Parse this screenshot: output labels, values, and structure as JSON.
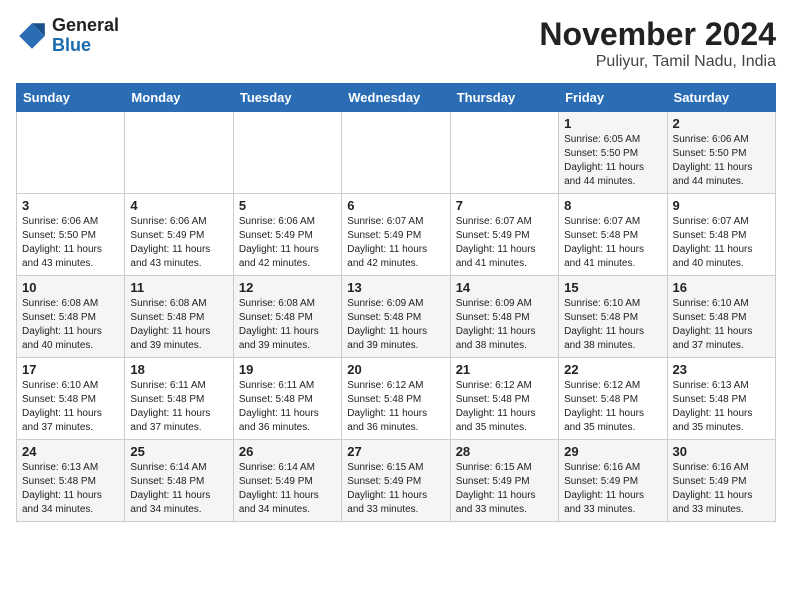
{
  "logo": {
    "general": "General",
    "blue": "Blue"
  },
  "title": "November 2024",
  "subtitle": "Puliyur, Tamil Nadu, India",
  "weekdays": [
    "Sunday",
    "Monday",
    "Tuesday",
    "Wednesday",
    "Thursday",
    "Friday",
    "Saturday"
  ],
  "weeks": [
    [
      {
        "day": "",
        "info": ""
      },
      {
        "day": "",
        "info": ""
      },
      {
        "day": "",
        "info": ""
      },
      {
        "day": "",
        "info": ""
      },
      {
        "day": "",
        "info": ""
      },
      {
        "day": "1",
        "info": "Sunrise: 6:05 AM\nSunset: 5:50 PM\nDaylight: 11 hours\nand 44 minutes."
      },
      {
        "day": "2",
        "info": "Sunrise: 6:06 AM\nSunset: 5:50 PM\nDaylight: 11 hours\nand 44 minutes."
      }
    ],
    [
      {
        "day": "3",
        "info": "Sunrise: 6:06 AM\nSunset: 5:50 PM\nDaylight: 11 hours\nand 43 minutes."
      },
      {
        "day": "4",
        "info": "Sunrise: 6:06 AM\nSunset: 5:49 PM\nDaylight: 11 hours\nand 43 minutes."
      },
      {
        "day": "5",
        "info": "Sunrise: 6:06 AM\nSunset: 5:49 PM\nDaylight: 11 hours\nand 42 minutes."
      },
      {
        "day": "6",
        "info": "Sunrise: 6:07 AM\nSunset: 5:49 PM\nDaylight: 11 hours\nand 42 minutes."
      },
      {
        "day": "7",
        "info": "Sunrise: 6:07 AM\nSunset: 5:49 PM\nDaylight: 11 hours\nand 41 minutes."
      },
      {
        "day": "8",
        "info": "Sunrise: 6:07 AM\nSunset: 5:48 PM\nDaylight: 11 hours\nand 41 minutes."
      },
      {
        "day": "9",
        "info": "Sunrise: 6:07 AM\nSunset: 5:48 PM\nDaylight: 11 hours\nand 40 minutes."
      }
    ],
    [
      {
        "day": "10",
        "info": "Sunrise: 6:08 AM\nSunset: 5:48 PM\nDaylight: 11 hours\nand 40 minutes."
      },
      {
        "day": "11",
        "info": "Sunrise: 6:08 AM\nSunset: 5:48 PM\nDaylight: 11 hours\nand 39 minutes."
      },
      {
        "day": "12",
        "info": "Sunrise: 6:08 AM\nSunset: 5:48 PM\nDaylight: 11 hours\nand 39 minutes."
      },
      {
        "day": "13",
        "info": "Sunrise: 6:09 AM\nSunset: 5:48 PM\nDaylight: 11 hours\nand 39 minutes."
      },
      {
        "day": "14",
        "info": "Sunrise: 6:09 AM\nSunset: 5:48 PM\nDaylight: 11 hours\nand 38 minutes."
      },
      {
        "day": "15",
        "info": "Sunrise: 6:10 AM\nSunset: 5:48 PM\nDaylight: 11 hours\nand 38 minutes."
      },
      {
        "day": "16",
        "info": "Sunrise: 6:10 AM\nSunset: 5:48 PM\nDaylight: 11 hours\nand 37 minutes."
      }
    ],
    [
      {
        "day": "17",
        "info": "Sunrise: 6:10 AM\nSunset: 5:48 PM\nDaylight: 11 hours\nand 37 minutes."
      },
      {
        "day": "18",
        "info": "Sunrise: 6:11 AM\nSunset: 5:48 PM\nDaylight: 11 hours\nand 37 minutes."
      },
      {
        "day": "19",
        "info": "Sunrise: 6:11 AM\nSunset: 5:48 PM\nDaylight: 11 hours\nand 36 minutes."
      },
      {
        "day": "20",
        "info": "Sunrise: 6:12 AM\nSunset: 5:48 PM\nDaylight: 11 hours\nand 36 minutes."
      },
      {
        "day": "21",
        "info": "Sunrise: 6:12 AM\nSunset: 5:48 PM\nDaylight: 11 hours\nand 35 minutes."
      },
      {
        "day": "22",
        "info": "Sunrise: 6:12 AM\nSunset: 5:48 PM\nDaylight: 11 hours\nand 35 minutes."
      },
      {
        "day": "23",
        "info": "Sunrise: 6:13 AM\nSunset: 5:48 PM\nDaylight: 11 hours\nand 35 minutes."
      }
    ],
    [
      {
        "day": "24",
        "info": "Sunrise: 6:13 AM\nSunset: 5:48 PM\nDaylight: 11 hours\nand 34 minutes."
      },
      {
        "day": "25",
        "info": "Sunrise: 6:14 AM\nSunset: 5:48 PM\nDaylight: 11 hours\nand 34 minutes."
      },
      {
        "day": "26",
        "info": "Sunrise: 6:14 AM\nSunset: 5:49 PM\nDaylight: 11 hours\nand 34 minutes."
      },
      {
        "day": "27",
        "info": "Sunrise: 6:15 AM\nSunset: 5:49 PM\nDaylight: 11 hours\nand 33 minutes."
      },
      {
        "day": "28",
        "info": "Sunrise: 6:15 AM\nSunset: 5:49 PM\nDaylight: 11 hours\nand 33 minutes."
      },
      {
        "day": "29",
        "info": "Sunrise: 6:16 AM\nSunset: 5:49 PM\nDaylight: 11 hours\nand 33 minutes."
      },
      {
        "day": "30",
        "info": "Sunrise: 6:16 AM\nSunset: 5:49 PM\nDaylight: 11 hours\nand 33 minutes."
      }
    ]
  ]
}
